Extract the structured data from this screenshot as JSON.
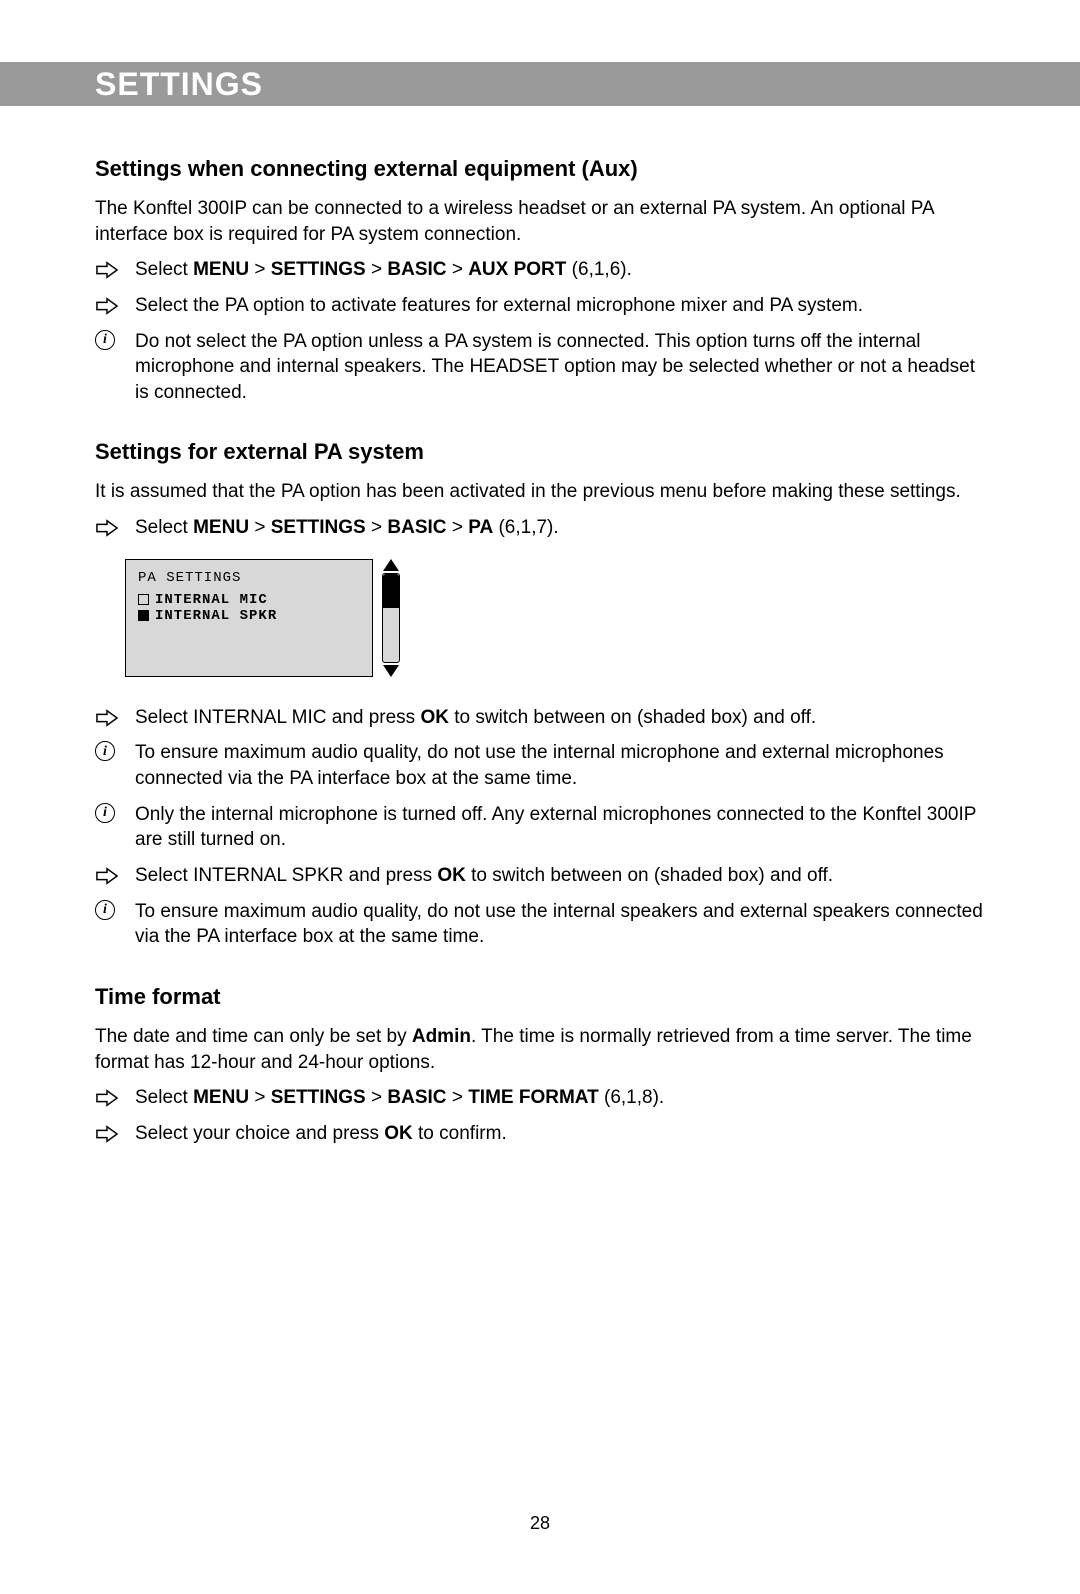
{
  "banner": {
    "title": "SETTINGS"
  },
  "sec1": {
    "heading": "Settings when connecting external equipment (Aux)",
    "intro": "The Konftel 300IP can be connected to a wireless headset or an external PA system. An optional PA interface box is required for PA system connection.",
    "items": [
      {
        "type": "arrow",
        "pre": "Select ",
        "path": [
          "MENU",
          "SETTINGS",
          "BASIC",
          "AUX PORT"
        ],
        "post": " (6,1,6)."
      },
      {
        "type": "arrow",
        "text": "Select the PA option to activate features for external microphone mixer and PA system."
      },
      {
        "type": "info",
        "text": "Do not select the PA option unless a PA system is connected. This option turns off the internal microphone and internal speakers. The HEADSET option may be selected whether or not a headset is connected."
      }
    ]
  },
  "sec2": {
    "heading": "Settings for external PA system",
    "intro": "It is assumed that the PA option has been activated in the previous menu before making these settings.",
    "nav": {
      "pre": "Select ",
      "path": [
        "MENU",
        "SETTINGS",
        "BASIC",
        "PA"
      ],
      "post": " (6,1,7)."
    },
    "lcd": {
      "title": "PA SETTINGS",
      "row1": "INTERNAL MIC",
      "row2": "INTERNAL SPKR"
    },
    "items": [
      {
        "type": "arrow",
        "pre": "Select INTERNAL MIC and press ",
        "bold": "OK",
        "post": " to switch between on (shaded box) and off."
      },
      {
        "type": "info",
        "text": "To ensure maximum audio quality, do not use the internal microphone and external microphones connected via the PA interface box at the same time."
      },
      {
        "type": "info",
        "text": "Only the internal microphone is turned off. Any external microphones connected to the Konftel 300IP are still turned on."
      },
      {
        "type": "arrow",
        "pre": "Select INTERNAL SPKR and press ",
        "bold": "OK",
        "post": " to switch between on (shaded box) and off."
      },
      {
        "type": "info",
        "text": "To ensure maximum audio quality, do not use the internal speakers and external speakers connected via the PA interface box at the same time."
      }
    ]
  },
  "sec3": {
    "heading": "Time format",
    "intro_pre": "The date and time can only be set by ",
    "intro_bold": "Admin",
    "intro_post": ". The time is normally retrieved from a time server. The time format has 12-hour and 24-hour options.",
    "items": [
      {
        "type": "arrow",
        "pre": "Select ",
        "path": [
          "MENU",
          "SETTINGS",
          "BASIC",
          "TIME FORMAT"
        ],
        "post": " (6,1,8)."
      },
      {
        "type": "arrow",
        "pre": "Select your choice and press ",
        "bold": "OK",
        "post": " to confirm."
      }
    ]
  },
  "page": "28",
  "glyph": {
    "gt": ">"
  }
}
